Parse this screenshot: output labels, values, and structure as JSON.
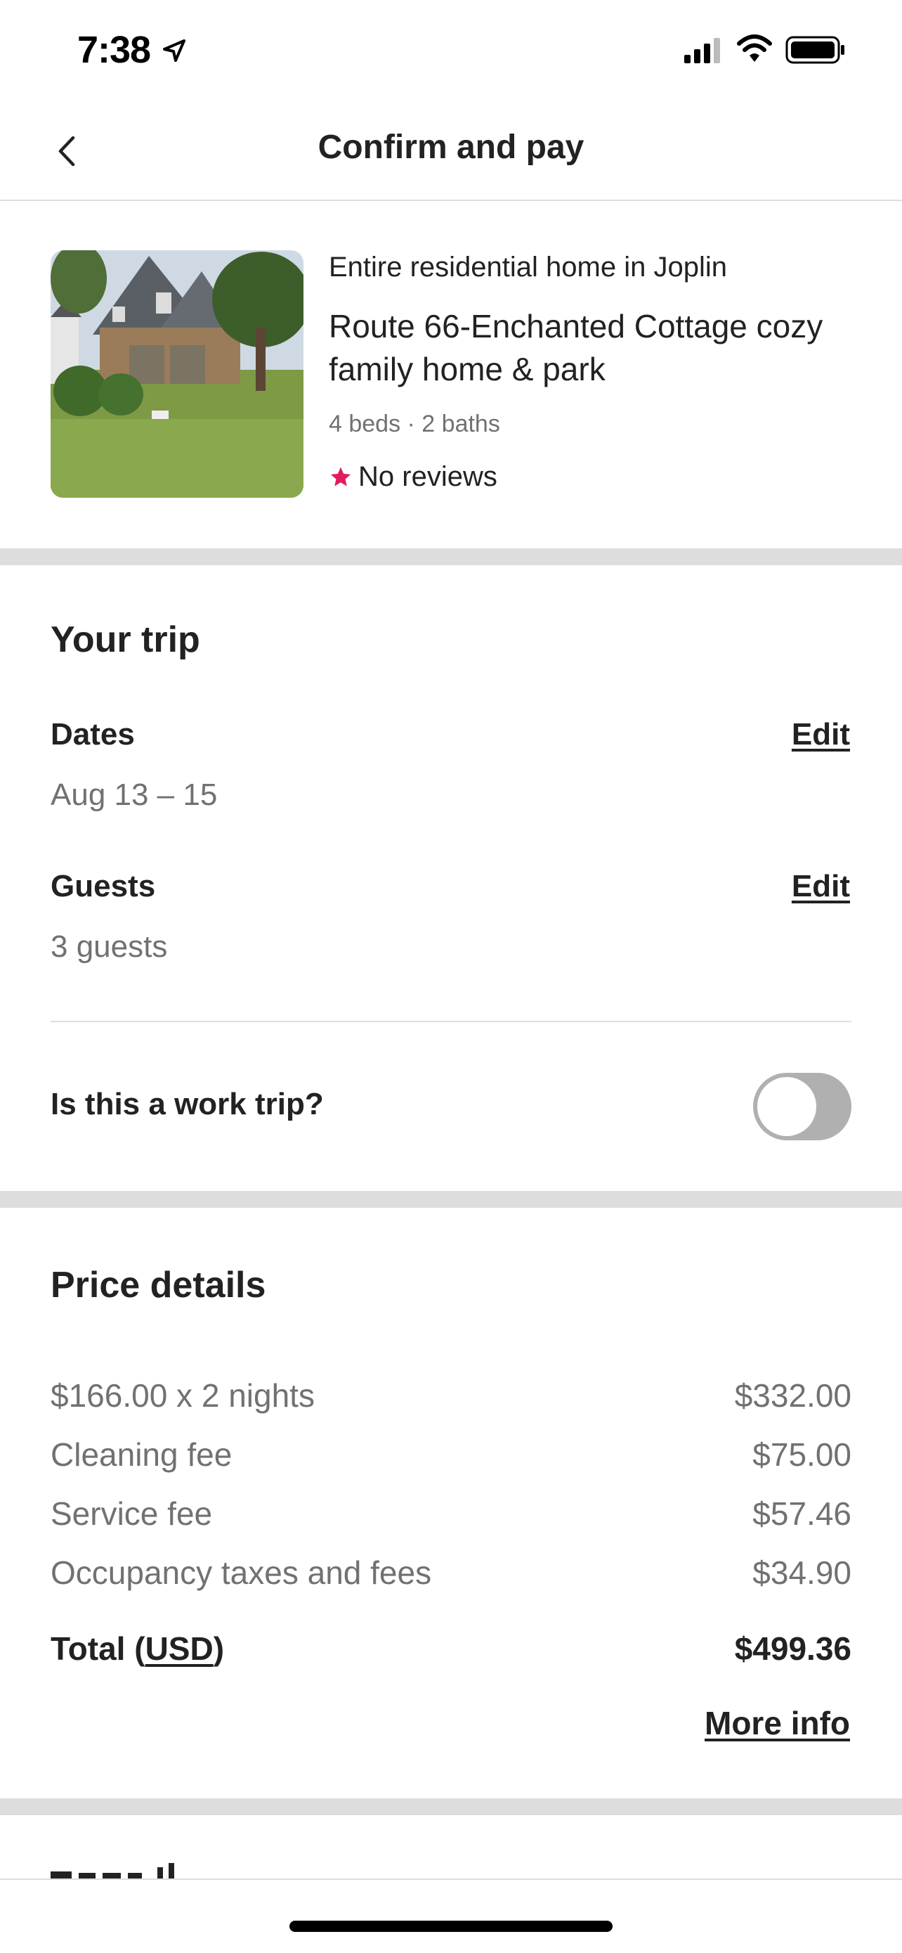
{
  "status_bar": {
    "time": "7:38"
  },
  "header": {
    "title": "Confirm and pay"
  },
  "listing": {
    "type": "Entire residential home in Joplin",
    "title": "Route 66-Enchanted Cottage cozy family home & park",
    "meta": "4 beds · 2 baths",
    "rating_text": "No reviews"
  },
  "trip": {
    "heading": "Your trip",
    "dates_label": "Dates",
    "dates_value": "Aug 13 – 15",
    "guests_label": "Guests",
    "guests_value": "3 guests",
    "edit_label": "Edit",
    "work_trip_label": "Is this a work trip?",
    "work_trip_enabled": false
  },
  "price": {
    "heading": "Price details",
    "items": [
      {
        "label": "$166.00 x 2 nights",
        "amount": "$332.00"
      },
      {
        "label": "Cleaning fee",
        "amount": "$75.00"
      },
      {
        "label": "Service fee",
        "amount": "$57.46"
      },
      {
        "label": "Occupancy taxes and fees",
        "amount": "$34.90"
      }
    ],
    "total_prefix": "Total (",
    "total_currency": "USD",
    "total_suffix": ")",
    "total_amount": "$499.36",
    "more_info": "More info"
  },
  "colors": {
    "accent_star": "#e31c5f",
    "divider": "#dddddd",
    "muted_text": "#717171"
  }
}
